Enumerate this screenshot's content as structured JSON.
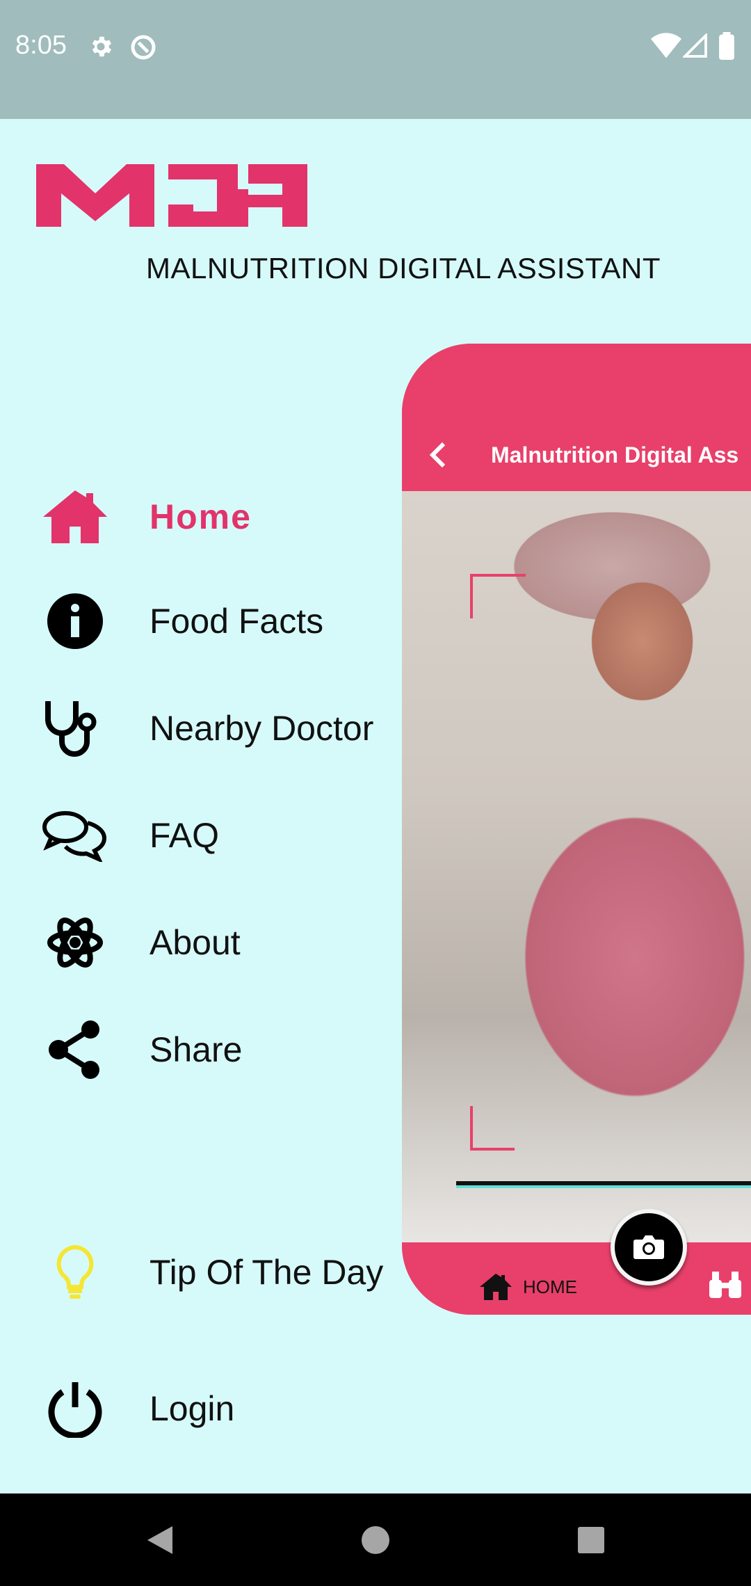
{
  "status_bar": {
    "time": "8:05",
    "icons": [
      "gear-icon",
      "at-sign-icon",
      "wifi-icon",
      "signal-icon",
      "battery-icon"
    ]
  },
  "app": {
    "logo_text": "MDA",
    "subtitle": "MALNUTRITION DIGITAL ASSISTANT",
    "accent_color": "#e2336a",
    "background_color": "#d6fafa"
  },
  "drawer": {
    "items": [
      {
        "label": "Home",
        "icon": "home-icon",
        "active": true
      },
      {
        "label": "Food Facts",
        "icon": "info-icon",
        "active": false
      },
      {
        "label": "Nearby Doctor",
        "icon": "stethoscope-icon",
        "active": false
      },
      {
        "label": "FAQ",
        "icon": "chat-bubbles-icon",
        "active": false
      },
      {
        "label": "About",
        "icon": "atom-icon",
        "active": false
      },
      {
        "label": "Share",
        "icon": "share-icon",
        "active": false
      },
      {
        "label": "Tip Of The Day",
        "icon": "lightbulb-icon",
        "active": false
      },
      {
        "label": "Login",
        "icon": "power-icon",
        "active": false
      }
    ]
  },
  "preview": {
    "title": "Malnutrition Digital Ass",
    "bottom_tab_home": "HOME",
    "icons": [
      "back-chevron-icon",
      "camera-icon",
      "home-icon",
      "binoculars-icon"
    ]
  },
  "nav_bar": {
    "buttons": [
      "back-triangle-icon",
      "home-circle-icon",
      "recents-square-icon"
    ]
  }
}
